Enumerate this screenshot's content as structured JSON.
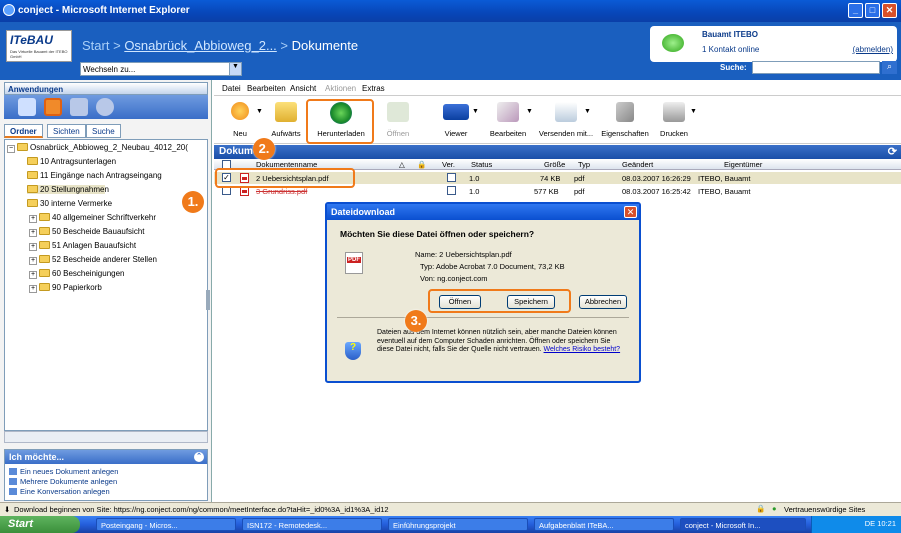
{
  "window": {
    "title": "conject - Microsoft Internet Explorer"
  },
  "header": {
    "logo_main": "ITeBAU",
    "logo_sub": "Das Virtuelle Bauamt der ITEBO GmbH",
    "crumb_start": "Start",
    "crumb_sep1": ">",
    "crumb_project": "Osnabrück_Abbioweg_2...",
    "crumb_sep2": ">",
    "crumb_current": "Dokumente",
    "switch_value": "Wechseln zu...",
    "contact_name": "Bauamt ITEBO",
    "contact_status": "1 Kontakt online",
    "logout": "(abmelden)",
    "search_label": "Suche:"
  },
  "left": {
    "apps_title": "Anwendungen",
    "tabs": [
      "Ordner",
      "Sichten",
      "Suche"
    ],
    "tree": [
      {
        "label": "Osnabrück_Abbioweg_2_Neubau_4012_20("
      },
      {
        "label": "10 Antragsunterlagen"
      },
      {
        "label": "11 Eingänge nach Antragseingang"
      },
      {
        "label": "20 Stellungnahmen"
      },
      {
        "label": "30 interne Vermerke"
      },
      {
        "label": "40 allgemeiner Schriftverkehr"
      },
      {
        "label": "50 Bescheide Bauaufsicht"
      },
      {
        "label": "51 Anlagen Bauaufsicht"
      },
      {
        "label": "52 Bescheide anderer Stellen"
      },
      {
        "label": "60 Bescheinigungen"
      },
      {
        "label": "90 Papierkorb"
      }
    ],
    "ich_title": "Ich möchte...",
    "ich_links": [
      "Ein neues Dokument anlegen",
      "Mehrere Dokumente anlegen",
      "Eine Konversation anlegen"
    ]
  },
  "menu": [
    "Datei",
    "Bearbeiten",
    "Ansicht",
    "Aktionen",
    "Extras"
  ],
  "toolbar": [
    "Neu",
    "Aufwärts",
    "Herunterladen",
    "Öffnen",
    "Viewer",
    "Bearbeiten",
    "Versenden mit...",
    "Eigenschaften",
    "Drucken"
  ],
  "docs": {
    "title": "Dokumente",
    "columns": {
      "name": "Dokumentenname",
      "ver": "Ver.",
      "status": "Status",
      "size": "Größe",
      "type": "Typ",
      "changed": "Geändert",
      "owner": "Eigentümer"
    },
    "rows": [
      {
        "name": "2 Uebersichtsplan.pdf",
        "ver": "1.0",
        "size": "74 KB",
        "type": "pdf",
        "changed": "08.03.2007 16:26:29",
        "owner": "ITEBO, Bauamt"
      },
      {
        "name": "3 Grundriss.pdf",
        "ver": "1.0",
        "size": "577 KB",
        "type": "pdf",
        "changed": "08.03.2007 16:25:42",
        "owner": "ITEBO, Bauamt"
      }
    ]
  },
  "dialog": {
    "title": "Dateidownload",
    "question": "Möchten Sie diese Datei öffnen oder speichern?",
    "name": "Name: 2 Uebersichtsplan.pdf",
    "type": "Typ: Adobe Acrobat 7.0 Document, 73,2 KB",
    "from": "Von: ng.conject.com",
    "open": "Öffnen",
    "save": "Speichern",
    "cancel": "Abbrechen",
    "warning": "Dateien aus dem Internet können nützlich sein, aber manche Dateien können eventuell auf dem Computer Schaden anrichten. Öffnen oder speichern Sie diese Datei nicht, falls Sie der Quelle nicht vertrauen.",
    "risk_link": "Welches Risiko besteht?"
  },
  "badges": [
    "1.",
    "2.",
    "3."
  ],
  "status": {
    "text": "Download beginnen von Site: https://ng.conject.com/ng/common/meetInterface.do?taHit=_id0%3A_id1%3A_id12",
    "zone": "Vertrauenswürdige Sites"
  },
  "taskbar": {
    "start": "Start",
    "tasks": [
      "Posteingang - Micros...",
      "ISN172 - Remotedesk...",
      "Einführungsprojekt",
      "Aufgabenblatt ITeBA...",
      "conject - Microsoft In..."
    ],
    "tray": "DE   10:21"
  }
}
